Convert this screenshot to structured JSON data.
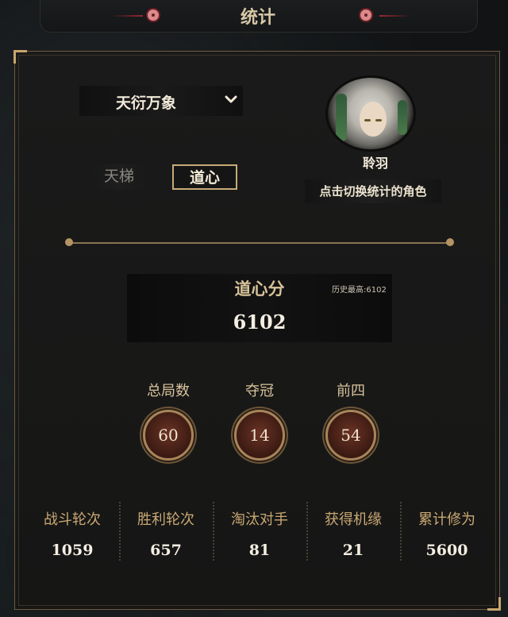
{
  "header": {
    "title": "统计"
  },
  "season": {
    "selected": "天衍万象"
  },
  "tabs": [
    {
      "label": "天梯"
    },
    {
      "label": "道心"
    }
  ],
  "character": {
    "name": "聆羽",
    "switch_label": "点击切换统计的角色"
  },
  "score": {
    "label": "道心分",
    "history_label": "历史最高:6102",
    "value": "6102"
  },
  "stats": [
    {
      "label": "总局数",
      "value": "60"
    },
    {
      "label": "夺冠",
      "value": "14"
    },
    {
      "label": "前四",
      "value": "54"
    }
  ],
  "bottom_stats": [
    {
      "label": "战斗轮次",
      "value": "1059"
    },
    {
      "label": "胜利轮次",
      "value": "657"
    },
    {
      "label": "淘汰对手",
      "value": "81"
    },
    {
      "label": "获得机缘",
      "value": "21"
    },
    {
      "label": "累计修为",
      "value": "5600"
    }
  ],
  "colors": {
    "accent_gold": "#c8aa78",
    "medal_brown": "#5a2a1e",
    "title_red": "#9a2630"
  }
}
